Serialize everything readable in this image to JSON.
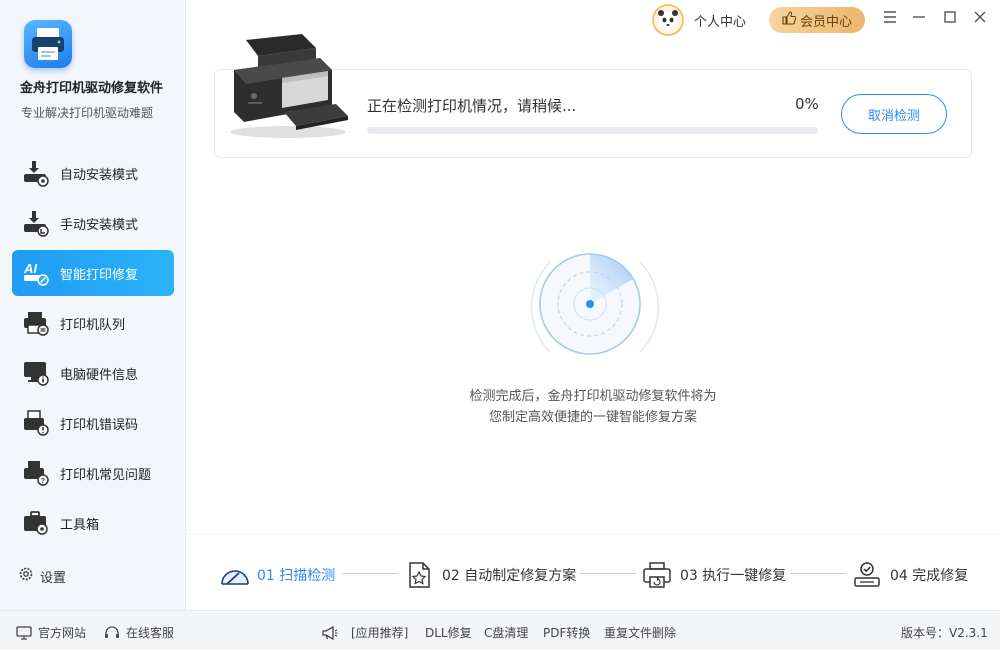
{
  "app": {
    "title": "金舟打印机驱动修复软件",
    "subtitle": "专业解决打印机驱动难题"
  },
  "sidebar": {
    "items": [
      {
        "label": "自动安装模式",
        "icon": "auto-install-icon"
      },
      {
        "label": "手动安装模式",
        "icon": "manual-install-icon"
      },
      {
        "label": "智能打印修复",
        "icon": "ai-repair-icon"
      },
      {
        "label": "打印机队列",
        "icon": "printer-queue-icon"
      },
      {
        "label": "电脑硬件信息",
        "icon": "hardware-info-icon"
      },
      {
        "label": "打印机错误码",
        "icon": "error-code-icon"
      },
      {
        "label": "打印机常见问题",
        "icon": "faq-icon"
      },
      {
        "label": "工具箱",
        "icon": "toolbox-icon"
      }
    ],
    "active_index": 2,
    "settings_label": "设置"
  },
  "topbar": {
    "user_label": "个人中心",
    "vip_label": "会员中心"
  },
  "detect": {
    "status": "正在检测打印机情况，请稍候...",
    "percent_text": "0%",
    "progress": 0,
    "cancel_label": "取消检测"
  },
  "radar": {
    "note_line1": "检测完成后，金舟打印机驱动修复软件将为",
    "note_line2": "您制定高效便捷的一键智能修复方案"
  },
  "steps": [
    {
      "label": "01 扫描检测",
      "icon": "scan-icon",
      "active": true
    },
    {
      "label": "02 自动制定修复方案",
      "icon": "plan-doc-icon",
      "active": false
    },
    {
      "label": "03 执行一键修复",
      "icon": "printer-repair-icon",
      "active": false
    },
    {
      "label": "04 完成修复",
      "icon": "complete-icon",
      "active": false
    }
  ],
  "bottom": {
    "official_site": "官方网站",
    "online_service": "在线客服",
    "recommend": "[应用推荐]",
    "links": [
      "DLL修复",
      "C盘清理",
      "PDF转换",
      "重复文件删除"
    ],
    "version": "版本号：V2.3.1"
  },
  "colors": {
    "accent": "#2d8cf0",
    "active_nav": "#1f9bf3",
    "vip_gold": "#e9b66e"
  }
}
